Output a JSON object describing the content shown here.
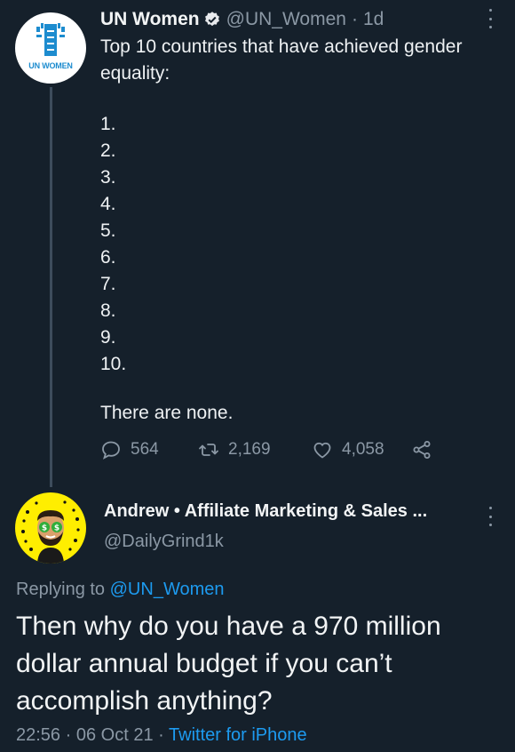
{
  "original_tweet": {
    "avatar_label": "UN WOMEN",
    "display_name": "UN Women",
    "handle": "@UN_Women",
    "separator": "·",
    "time_ago": "1d",
    "text_intro": "Top 10 countries that have achieved gender equality:",
    "list_items": [
      "1.",
      "2.",
      "3.",
      "4.",
      "5.",
      "6.",
      "7.",
      "8.",
      "9.",
      "10."
    ],
    "text_closing": "There are none.",
    "replies": "564",
    "retweets": "2,169",
    "likes": "4,058"
  },
  "reply_tweet": {
    "display_name": "Andrew • Affiliate Marketing & Sales ...",
    "handle": "@DailyGrind1k",
    "replying_prefix": "Replying to",
    "replying_handle": "@UN_Women",
    "text": "Then why do you have a 970 million dollar annual budget if you can’t accomplish anything?",
    "time": "22:56",
    "date": "06 Oct 21",
    "source": "Twitter for iPhone"
  },
  "colors": {
    "background": "#15202b",
    "accent_link": "#1d9bf0",
    "muted": "#8b98a5",
    "un_blue": "#1d8ccf"
  },
  "icons": [
    "verified-badge-icon",
    "more-options-icon",
    "reply-icon",
    "retweet-icon",
    "like-icon",
    "share-icon"
  ]
}
